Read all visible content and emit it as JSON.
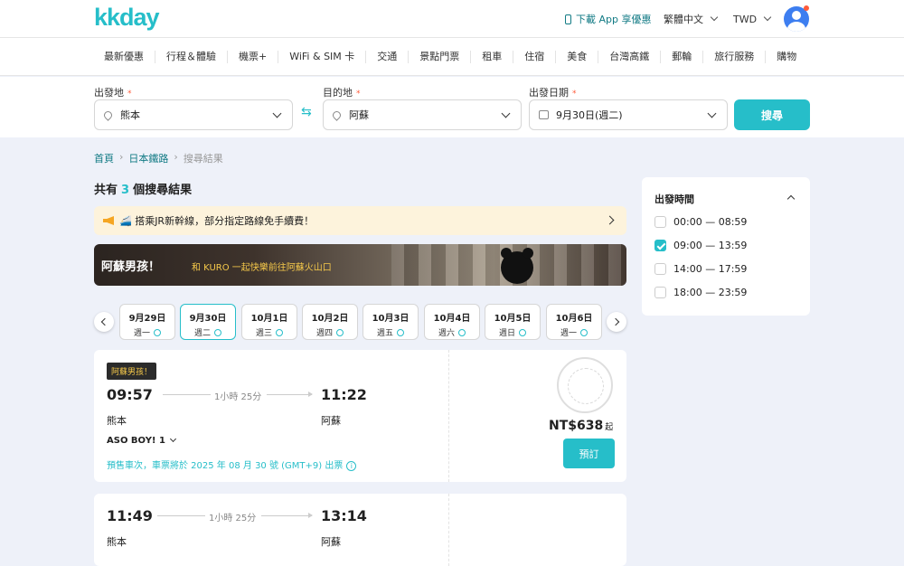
{
  "header": {
    "logo": "kkday",
    "download": "下載 App 享優惠",
    "language": "繁體中文",
    "currency": "TWD"
  },
  "nav": [
    "最新優惠",
    "行程＆體驗",
    "機票+",
    "WiFi & SIM 卡",
    "交通",
    "景點門票",
    "租車",
    "住宿",
    "美食",
    "台灣高鐵",
    "郵輪",
    "旅行服務",
    "購物"
  ],
  "search": {
    "from_label": "出發地",
    "from_value": "熊本",
    "to_label": "目的地",
    "to_value": "阿蘇",
    "date_label": "出發日期",
    "date_value": "9月30日(週二)",
    "required_mark": "*",
    "button": "搜尋",
    "swap_icon": "⇆"
  },
  "breadcrumb": {
    "home": "首頁",
    "category": "日本鐵路",
    "current": "搜尋結果",
    "sep": "›"
  },
  "results": {
    "prefix": "共有",
    "count": "3",
    "suffix": "個搜尋結果"
  },
  "notice": "🚄 搭乘JR新幹線，部分指定路線免手續費！",
  "banner": {
    "title": "阿蘇男孩！",
    "subtitle": "和 KURO 一起快樂前往阿蘇火山口"
  },
  "dates": [
    {
      "date": "9月29日",
      "weekday": "週一"
    },
    {
      "date": "9月30日",
      "weekday": "週二"
    },
    {
      "date": "10月1日",
      "weekday": "週三"
    },
    {
      "date": "10月2日",
      "weekday": "週四"
    },
    {
      "date": "10月3日",
      "weekday": "週五"
    },
    {
      "date": "10月4日",
      "weekday": "週六"
    },
    {
      "date": "10月5日",
      "weekday": "週日"
    },
    {
      "date": "10月6日",
      "weekday": "週一"
    }
  ],
  "trains": [
    {
      "tag": "阿蘇男孩！",
      "depart": "09:57",
      "arrive": "11:22",
      "duration": "1小時 25分",
      "from": "熊本",
      "to": "阿蘇",
      "name": "ASO BOY! 1",
      "presale": "預售車次，車票將於 2025 年 08 月 30 號 (GMT+9) 出票",
      "info_icon": "i",
      "price": "NT$638",
      "price_suffix": "起",
      "book": "預訂"
    },
    {
      "depart": "11:49",
      "arrive": "13:14",
      "duration": "1小時 25分",
      "from": "熊本",
      "to": "阿蘇"
    }
  ],
  "filter": {
    "title": "出發時間",
    "options": [
      {
        "label": "00:00 — 08:59",
        "checked": false
      },
      {
        "label": "09:00 — 13:59",
        "checked": true
      },
      {
        "label": "14:00 — 17:59",
        "checked": false
      },
      {
        "label": "18:00 — 23:59",
        "checked": false
      }
    ]
  },
  "colors": {
    "brand": "#26bec9",
    "brand_dark": "#117a84",
    "notice_bg": "#fdf3dc",
    "page_bg": "#eef1f9"
  }
}
